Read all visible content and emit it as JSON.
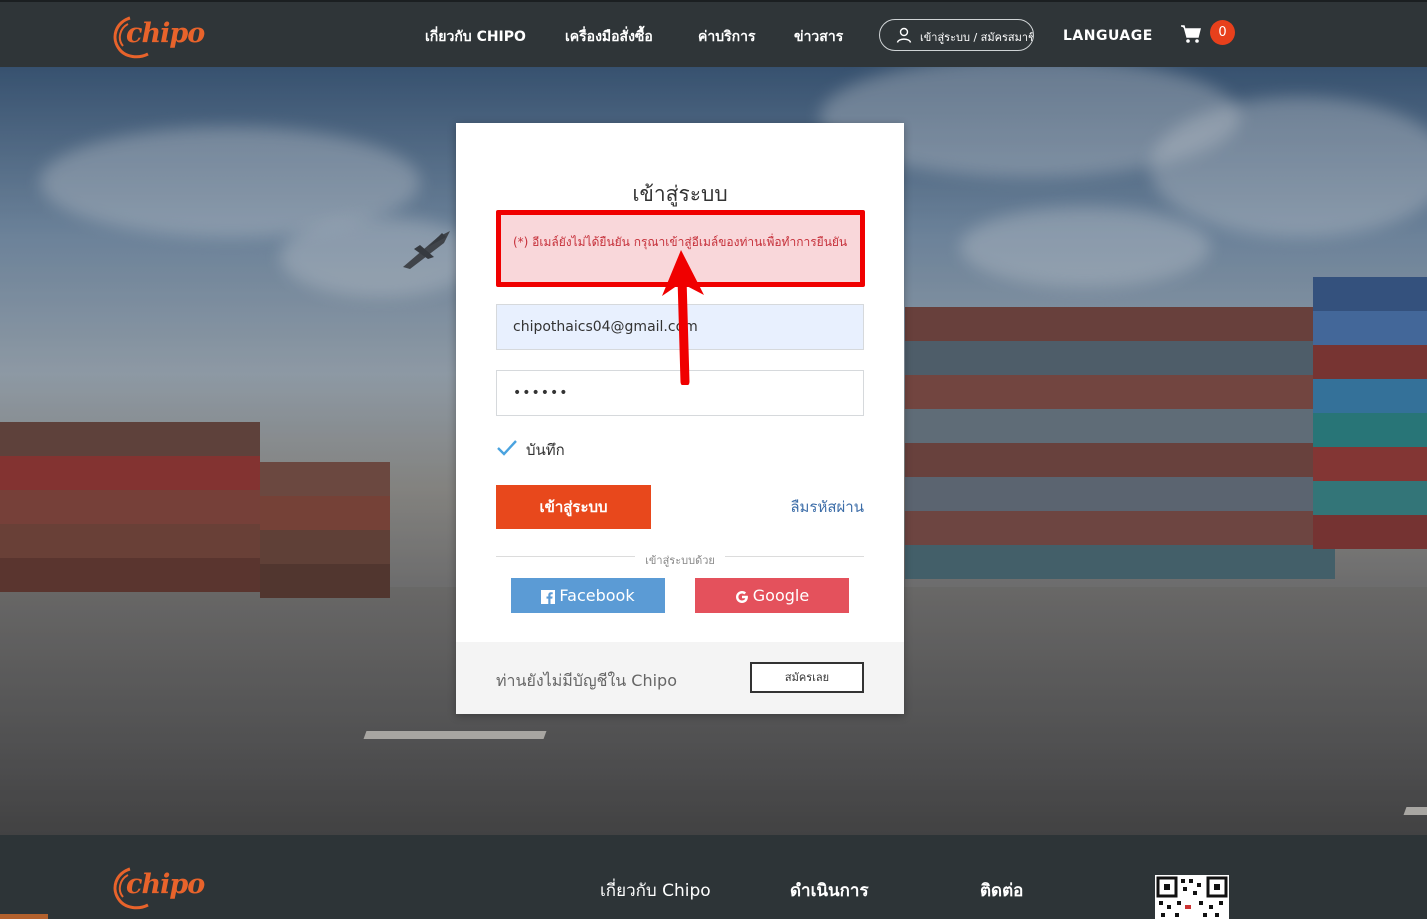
{
  "brand": {
    "name": "chipo",
    "color": "#e8632b"
  },
  "header": {
    "nav": [
      "เกี่ยวกับ CHIPO",
      "เครื่องมือสั่งซื้อ",
      "ค่าบริการ",
      "ข่าวสาร"
    ],
    "login_pill": "เข้าสู่ระบบ / สมัครสมาชิ",
    "language": "LANGUAGE",
    "cart_count": "0"
  },
  "login": {
    "title": "เข้าสู่ระบบ",
    "alert": "(*) อีเมล์ยังไม่ได้ยืนยัน กรุณาเข้าสู่อีเมล์ของท่านเพื่อทำการยืนยัน",
    "email_value": "chipothaics04@gmail.com",
    "password_value": "••••••",
    "remember_label": "บันทึก",
    "submit_label": "เข้าสู่ระบบ",
    "forgot_label": "ลืมรหัสผ่าน",
    "social_divider": "เข้าสู่ระบบด้วย",
    "facebook_label": "Facebook",
    "google_label": "Google",
    "no_account_text": "ท่านยังไม่มีบัญชีใน Chipo",
    "signup_label": "สมัครเลย"
  },
  "footer": {
    "columns": [
      "เกี่ยวกับ Chipo",
      "ดำเนินการ",
      "ติดต่อ"
    ]
  },
  "colors": {
    "accent": "#e8481c",
    "alert_border": "#f00000",
    "facebook": "#5b9bd5",
    "google": "#e4515c"
  }
}
